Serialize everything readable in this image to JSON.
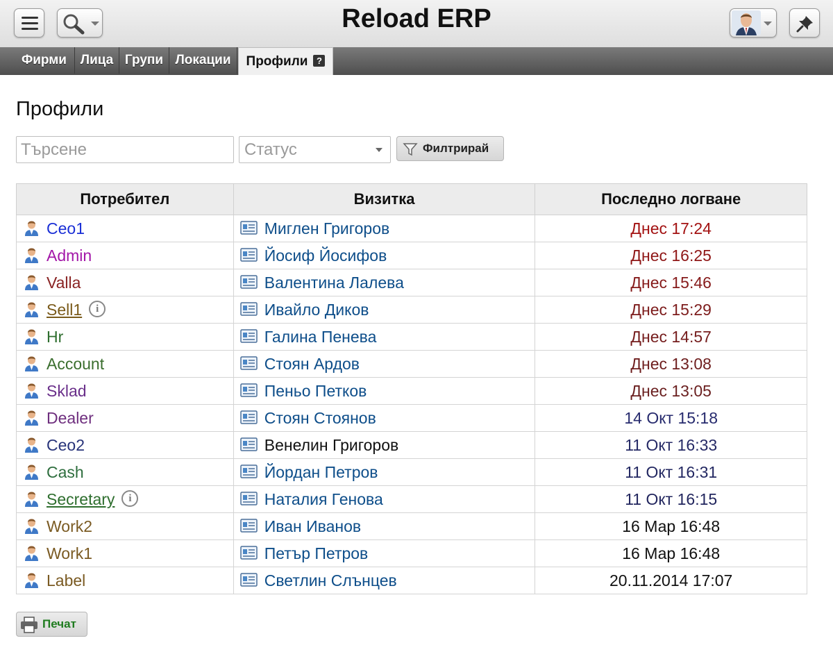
{
  "app": {
    "title": "Reload ERP"
  },
  "tabs": [
    {
      "label": "Фирми"
    },
    {
      "label": "Лица"
    },
    {
      "label": "Групи"
    },
    {
      "label": "Локации"
    },
    {
      "label": "Профили",
      "active": true,
      "help": "?"
    }
  ],
  "page": {
    "title": "Профили"
  },
  "filters": {
    "search_placeholder": "Търсене",
    "status_placeholder": "Статус",
    "filter_label": "Филтрирай"
  },
  "table": {
    "columns": [
      "Потребител",
      "Визитка",
      "Последно логване"
    ],
    "rows": [
      {
        "user": "Ceo1",
        "user_color": "#1a2fd6",
        "card": "Миглен Григоров",
        "card_link": true,
        "last": "Днес 17:24",
        "last_color": "#a31212",
        "info": false
      },
      {
        "user": "Admin",
        "user_color": "#a316a8",
        "card": "Йосиф Йосифов",
        "card_link": true,
        "last": "Днес 16:25",
        "last_color": "#8f1717",
        "info": false
      },
      {
        "user": "Valla",
        "user_color": "#8a2424",
        "card": "Валентина Лалева",
        "card_link": true,
        "last": "Днес 15:46",
        "last_color": "#861b1b",
        "info": false
      },
      {
        "user": "Sell1",
        "user_color": "#7a5a1a",
        "card": "Ивайло Диков",
        "card_link": true,
        "last": "Днес 15:29",
        "last_color": "#7d1c1c",
        "info": true,
        "underline": true
      },
      {
        "user": "Hr",
        "user_color": "#2e6e2e",
        "card": "Галина Пенева",
        "card_link": true,
        "last": "Днес 14:57",
        "last_color": "#751d1d",
        "info": false
      },
      {
        "user": "Account",
        "user_color": "#3a6e2e",
        "card": "Стоян Ардов",
        "card_link": true,
        "last": "Днес 13:08",
        "last_color": "#6e1e1e",
        "info": false
      },
      {
        "user": "Sklad",
        "user_color": "#6a2f8a",
        "card": "Пеньо Петков",
        "card_link": true,
        "last": "Днес 13:05",
        "last_color": "#6a1f1f",
        "info": false
      },
      {
        "user": "Dealer",
        "user_color": "#6e2e7e",
        "card": "Стоян Стоянов",
        "card_link": true,
        "last": "14 Окт 15:18",
        "last_color": "#272b6e",
        "info": false
      },
      {
        "user": "Ceo2",
        "user_color": "#28347a",
        "card": "Венелин Григоров",
        "card_link": false,
        "last": "11 Окт 16:33",
        "last_color": "#262a66",
        "info": false
      },
      {
        "user": "Cash",
        "user_color": "#2e6e3e",
        "card": "Йордан Петров",
        "card_link": true,
        "last": "11 Окт 16:31",
        "last_color": "#232862",
        "info": false
      },
      {
        "user": "Secretary",
        "user_color": "#2e6e2e",
        "card": "Наталия Генова",
        "card_link": true,
        "last": "11 Окт 16:15",
        "last_color": "#22265e",
        "info": true,
        "underline": true
      },
      {
        "user": "Work2",
        "user_color": "#7a5a22",
        "card": "Иван Иванов",
        "card_link": true,
        "last": "16 Мар 16:48",
        "last_color": "#111111",
        "info": false
      },
      {
        "user": "Work1",
        "user_color": "#7a5a22",
        "card": "Петър Петров",
        "card_link": true,
        "last": "16 Мар 16:48",
        "last_color": "#111111",
        "info": false
      },
      {
        "user": "Label",
        "user_color": "#7a5a22",
        "card": "Светлин Слънцев",
        "card_link": true,
        "last": "20.11.2014 17:07",
        "last_color": "#111111",
        "info": false
      }
    ]
  },
  "footer": {
    "print_label": "Печат"
  },
  "icons": {
    "menu": "hamburger-icon",
    "search": "magnifier-icon",
    "pin": "pin-icon",
    "user": "user-icon",
    "card": "business-card-icon",
    "filter": "funnel-icon",
    "print": "printer-icon",
    "info": "info-icon"
  }
}
